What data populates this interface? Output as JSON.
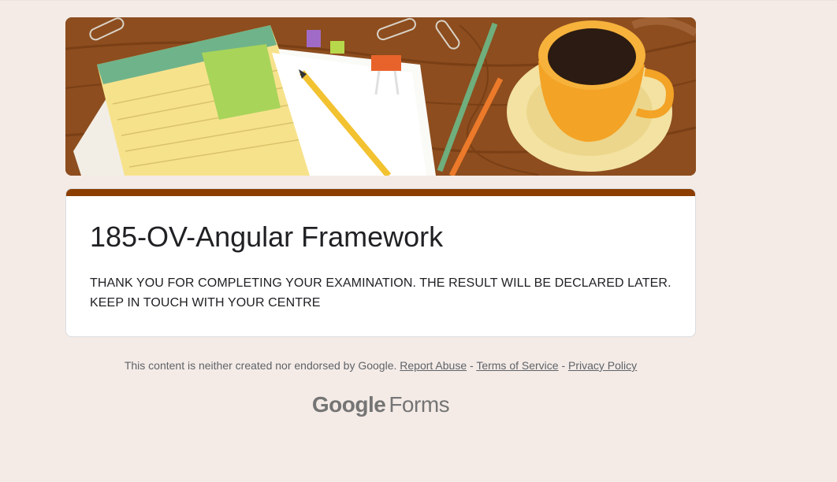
{
  "form": {
    "title": "185-OV-Angular Framework",
    "confirmation": "THANK YOU FOR COMPLETING YOUR EXAMINATION. THE RESULT WILL BE DECLARED LATER. KEEP IN TOUCH WITH YOUR CENTRE"
  },
  "footer": {
    "disclaimer": "This content is neither created nor endorsed by Google.",
    "separator": "-",
    "report_abuse": "Report Abuse",
    "terms": "Terms of Service",
    "privacy": "Privacy Policy"
  },
  "brand": {
    "google": "Google",
    "forms": "Forms"
  },
  "colors": {
    "accent": "#8b3e00",
    "page_background": "#f4ebe7"
  }
}
